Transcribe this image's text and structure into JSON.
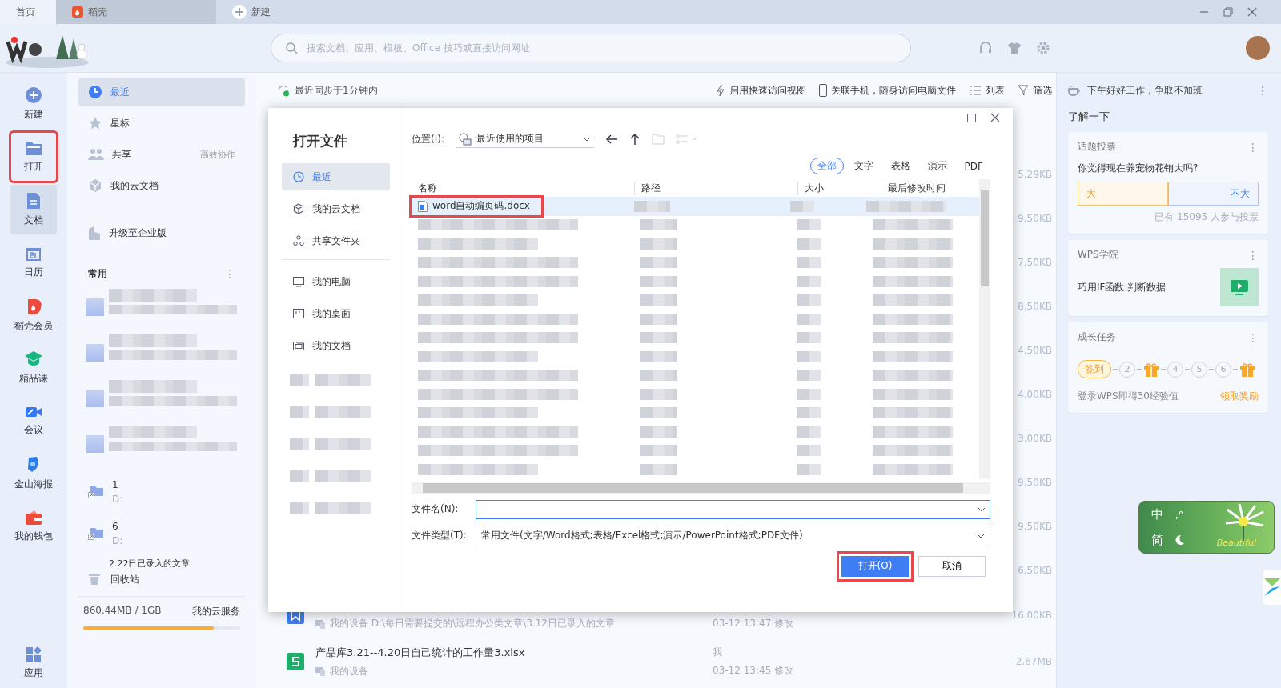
{
  "tabs": [
    {
      "label": "首页",
      "selected": true,
      "kind": "home"
    },
    {
      "label": "稻壳",
      "selected": false,
      "kind": "docer"
    },
    {
      "label": "新建",
      "selected": false,
      "kind": "new"
    }
  ],
  "search": {
    "placeholder": "搜索文档、应用、模板、Office 技巧或直接访问网址"
  },
  "rail": [
    {
      "label": "新建",
      "kind": "plus",
      "selected": false,
      "highlighted": false
    },
    {
      "label": "打开",
      "kind": "folder",
      "selected": false,
      "highlighted": true
    },
    {
      "label": "文档",
      "kind": "doc",
      "selected": true,
      "highlighted": false
    },
    {
      "label": "日历",
      "kind": "calendar",
      "selected": false,
      "highlighted": false
    },
    {
      "label": "稻壳会员",
      "kind": "docer",
      "selected": false,
      "highlighted": false
    },
    {
      "label": "精品课",
      "kind": "course",
      "selected": false,
      "highlighted": false
    },
    {
      "label": "会议",
      "kind": "meeting",
      "selected": false,
      "highlighted": false
    },
    {
      "label": "金山海报",
      "kind": "poster",
      "selected": false,
      "highlighted": false
    },
    {
      "label": "我的钱包",
      "kind": "wallet",
      "selected": false,
      "highlighted": false
    }
  ],
  "rail_bottom": {
    "label": "应用"
  },
  "nav": {
    "items": [
      {
        "label": "最近",
        "kind": "clock",
        "selected": true
      },
      {
        "label": "星标",
        "kind": "star",
        "selected": false
      },
      {
        "label": "共享",
        "kind": "people",
        "selected": false,
        "hint": "高效协作"
      },
      {
        "label": "我的云文档",
        "kind": "cube",
        "selected": false
      },
      {
        "label": "升级至企业版",
        "kind": "building",
        "selected": false
      }
    ],
    "section": "常用",
    "section_menu": "⋮",
    "folders": [
      {
        "name": "1",
        "path": "D:"
      },
      {
        "name": "6",
        "path": "D:"
      }
    ],
    "cut_item": "2.22日已录入的文章",
    "trash": "回收站",
    "storage": {
      "used": "860.44MB / 1GB",
      "link": "我的云服务",
      "level": 0.83
    }
  },
  "toolbar": {
    "sync": "最近同步于1分钟内",
    "actions": [
      {
        "label": "启用快速访问视图",
        "kind": "bolt"
      },
      {
        "label": "关联手机，随身访问电脑文件",
        "kind": "phone"
      },
      {
        "label": "列表",
        "kind": "list"
      },
      {
        "label": "筛选",
        "kind": "filter"
      }
    ]
  },
  "sizes": [
    "5.29KB",
    "9.50KB",
    "7.50KB",
    "8.50KB",
    "4.50KB",
    "4.00KB",
    "3.00KB",
    "9.50KB",
    "9.50KB",
    "6.50KB"
  ],
  "files": [
    {
      "kind": "word",
      "location": "我的设备 D:\\每日需要提交的\\远程办公类文章\\3.12日已录入的文章",
      "time": "03-12 13:47 修改",
      "size": "16.00KB"
    },
    {
      "kind": "sheet",
      "title": "产品库3.21--4.20日自己统计的工作量3.xlsx",
      "location": "我的设备",
      "owner": "我",
      "time": "03-12 13:45 修改",
      "size": "2.67MB"
    }
  ],
  "right": {
    "greeting": "下午好好工作，争取不加班",
    "greeting_menu": "⋮",
    "heading": "了解一下",
    "poll": {
      "title": "话题投票",
      "menu": "⋮",
      "question": "你觉得现在养宠物花销大吗?",
      "options": [
        "大",
        "不大"
      ],
      "count": "已有 15095 人参与投票"
    },
    "academy": {
      "title": "WPS学院",
      "menu": "⋮",
      "lesson": "巧用IF函数 判断数据"
    },
    "growth": {
      "title": "成长任务",
      "menu": "⋮",
      "steps": [
        {
          "kind": "label",
          "text": "签到"
        },
        {
          "kind": "number",
          "text": "2"
        },
        {
          "kind": "gift"
        },
        {
          "kind": "number",
          "text": "4"
        },
        {
          "kind": "number",
          "text": "5"
        },
        {
          "kind": "number",
          "text": "6"
        },
        {
          "kind": "gift"
        }
      ],
      "note": "登录WPS即得30经验值",
      "reward": "领取奖励"
    }
  },
  "ime": {
    "lang": "中",
    "script": "简",
    "punct": ",°",
    "skin": "Beautiful"
  },
  "dialog": {
    "title": "打开文件",
    "places": [
      {
        "label": "最近",
        "kind": "clock",
        "selected": true
      },
      {
        "label": "我的云文档",
        "kind": "cube",
        "selected": false
      },
      {
        "label": "共享文件夹",
        "kind": "share",
        "selected": false
      },
      {
        "label": "我的电脑",
        "kind": "pc",
        "selected": false
      },
      {
        "label": "我的桌面",
        "kind": "desktop",
        "selected": false
      },
      {
        "label": "我的文档",
        "kind": "docs",
        "selected": false
      }
    ],
    "location_label": "位置(I):",
    "location": "最近使用的项目",
    "filters": [
      {
        "label": "全部",
        "selected": true
      },
      {
        "label": "文字",
        "selected": false
      },
      {
        "label": "表格",
        "selected": false
      },
      {
        "label": "演示",
        "selected": false
      },
      {
        "label": "PDF",
        "selected": false
      }
    ],
    "columns": [
      "名称",
      "路径",
      "大小",
      "最后修改时间"
    ],
    "first_file": {
      "name": "word自动编页码.docx",
      "selected": true,
      "highlighted": true
    },
    "filename_label": "文件名(N):",
    "filetype_label": "文件类型(T):",
    "filetype": "常用文件(文字/Word格式;表格/Excel格式;演示/PowerPoint格式;PDF文件)",
    "buttons": [
      {
        "label": "打开(O)",
        "kind": "primary",
        "highlighted": true
      },
      {
        "label": "取消",
        "kind": "secondary",
        "highlighted": false
      }
    ]
  }
}
